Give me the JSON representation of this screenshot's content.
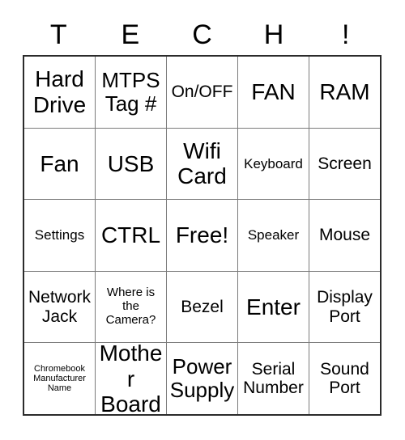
{
  "card": {
    "title_letters": [
      "T",
      "E",
      "C",
      "H",
      "!"
    ],
    "free_space_label": "Free!",
    "grid": {
      "rows": 5,
      "columns": 5,
      "cells": [
        [
          {
            "label": "Hard Drive",
            "size": "xl"
          },
          {
            "label": "MTPS Tag #",
            "size": "lg"
          },
          {
            "label": "On/OFF",
            "size": "md"
          },
          {
            "label": "FAN",
            "size": "xl"
          },
          {
            "label": "RAM",
            "size": "xl"
          }
        ],
        [
          {
            "label": "Fan",
            "size": "xl"
          },
          {
            "label": "USB",
            "size": "xl"
          },
          {
            "label": "Wifi Card",
            "size": "xl"
          },
          {
            "label": "Keyboard",
            "size": "sm"
          },
          {
            "label": "Screen",
            "size": "md"
          }
        ],
        [
          {
            "label": "Settings",
            "size": "sm"
          },
          {
            "label": "CTRL",
            "size": "xl"
          },
          {
            "label": "Free!",
            "size": "xl"
          },
          {
            "label": "Speaker",
            "size": "sm"
          },
          {
            "label": "Mouse",
            "size": "md"
          }
        ],
        [
          {
            "label": "Network Jack",
            "size": "md"
          },
          {
            "label": "Where is the Camera?",
            "size": "xs"
          },
          {
            "label": "Bezel",
            "size": "md"
          },
          {
            "label": "Enter",
            "size": "xl"
          },
          {
            "label": "Display Port",
            "size": "md"
          }
        ],
        [
          {
            "label": "Chromebook Manufacturer Name",
            "size": "xxs"
          },
          {
            "label": "Mother Board",
            "size": "xl"
          },
          {
            "label": "Power Supply",
            "size": "lg"
          },
          {
            "label": "Serial Number",
            "size": "md"
          },
          {
            "label": "Sound Port",
            "size": "md"
          }
        ]
      ]
    },
    "colors": {
      "background": "#ffffff",
      "text": "#000000",
      "outer_border": "#2b2b2b",
      "inner_border": "#7a7a7a"
    }
  }
}
